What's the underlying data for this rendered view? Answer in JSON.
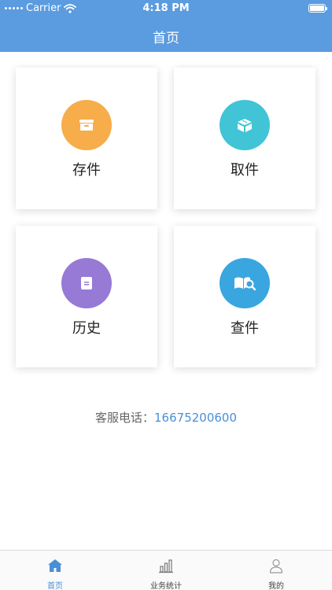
{
  "status_bar": {
    "carrier": "Carrier",
    "time": "4:18 PM"
  },
  "nav": {
    "title": "首页"
  },
  "cards": [
    {
      "label": "存件",
      "icon": "box-icon",
      "color": "#f6ad4a"
    },
    {
      "label": "取件",
      "icon": "open-box-icon",
      "color": "#41c4d6"
    },
    {
      "label": "历史",
      "icon": "document-icon",
      "color": "#9779d6"
    },
    {
      "label": "查件",
      "icon": "book-search-icon",
      "color": "#39a6e0"
    }
  ],
  "service": {
    "label": "客服电话：",
    "phone": "16675200600"
  },
  "tabbar": {
    "items": [
      {
        "label": "首页",
        "icon": "home-icon",
        "active": true
      },
      {
        "label": "业务统计",
        "icon": "bar-chart-icon",
        "active": false
      },
      {
        "label": "我的",
        "icon": "person-icon",
        "active": false
      }
    ],
    "active_color": "#4a8fd6",
    "inactive_color": "#666666"
  }
}
